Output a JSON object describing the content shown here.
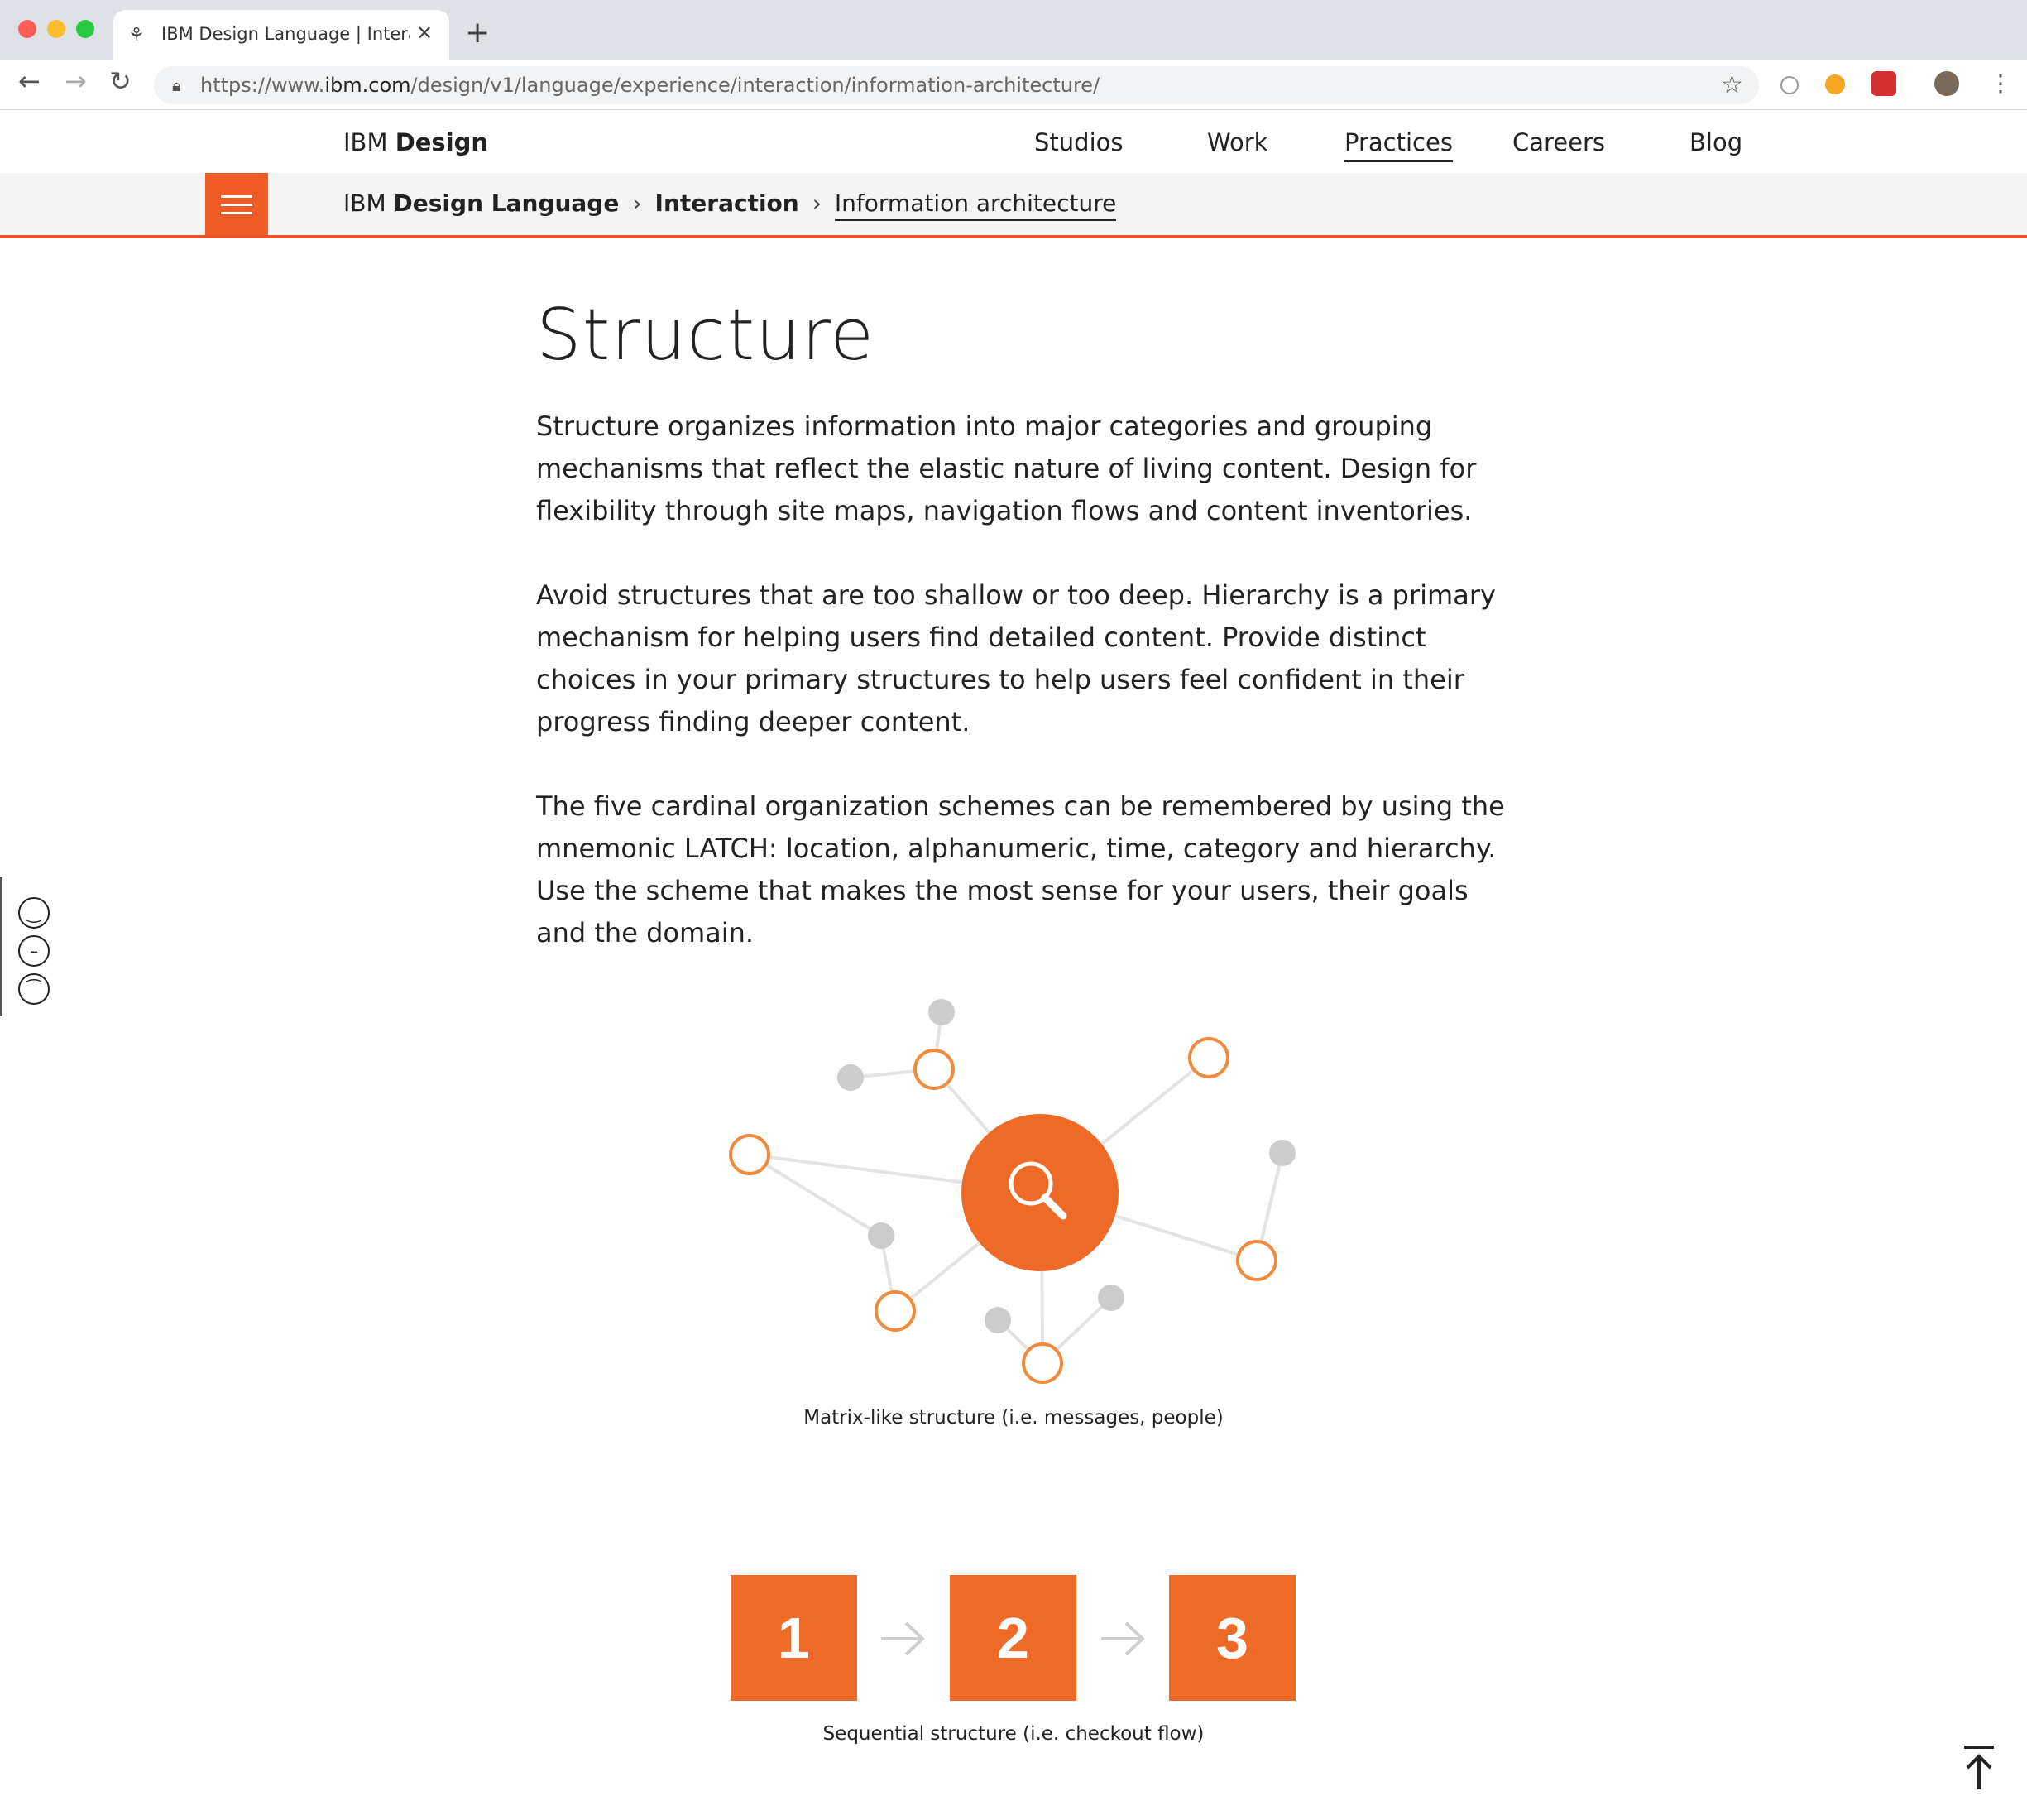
{
  "browser": {
    "tab_title": "IBM Design Language | Interac",
    "tab_favicon": "bicycle-icon",
    "url_prefix": "https://www.",
    "url_domain": "ibm.com",
    "url_path": "/design/v1/language/experience/interaction/information-architecture/"
  },
  "header": {
    "brand_light": "IBM",
    "brand_bold": "Design",
    "nav": [
      {
        "label": "Studios"
      },
      {
        "label": "Work"
      },
      {
        "label": "Practices",
        "active": true
      },
      {
        "label": "Careers"
      },
      {
        "label": "Blog"
      }
    ]
  },
  "breadcrumb": {
    "prefix": "IBM",
    "item1": "Design Language",
    "item2": "Interaction",
    "item3": "Information architecture"
  },
  "content": {
    "title": "Structure",
    "paragraphs": [
      "Structure organizes information into major categories and grouping mechanisms that reflect the elastic nature of living content. Design for flexibility through site maps, navigation flows and content inventories.",
      "Avoid structures that are too shallow or too deep. Hierarchy is a primary mechanism for helping users find detailed content. Provide distinct choices in your primary structures to help users feel confident in their progress finding deeper content.",
      "The five cardinal organization schemes can be remembered by using the mnemonic LATCH: location, alphanumeric, time, category and hierarchy. Use the scheme that makes the most sense for your users, their goals and the domain."
    ],
    "figure1_caption": "Matrix-like structure (i.e. messages, people)",
    "figure2_caption": "Sequential structure (i.e. checkout flow)",
    "steps": [
      "1",
      "2",
      "3"
    ]
  },
  "colors": {
    "accent": "#ef5b25",
    "node_orange": "#f08a3c",
    "node_gray": "#cccccc",
    "link_gray": "#e3e3e3"
  }
}
